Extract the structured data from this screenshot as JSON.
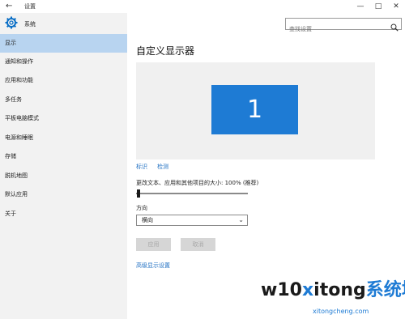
{
  "window": {
    "title": "设置",
    "back_glyph": "←",
    "minimize_glyph": "—",
    "maximize_glyph": "□",
    "close_glyph": "✕"
  },
  "sidebar": {
    "header": "系统",
    "items": [
      {
        "label": "显示",
        "active": true
      },
      {
        "label": "通知和操作"
      },
      {
        "label": "应用和功能"
      },
      {
        "label": "多任务"
      },
      {
        "label": "平板电脑模式"
      },
      {
        "label": "电源和睡眠"
      },
      {
        "label": "存储"
      },
      {
        "label": "脱机地图"
      },
      {
        "label": "默认应用"
      },
      {
        "label": "关于"
      }
    ]
  },
  "search": {
    "placeholder": "查找设置"
  },
  "main": {
    "title": "自定义显示器",
    "monitor_number": "1",
    "identify_link": "标识",
    "detect_link": "检测",
    "scale_label": "更改文本、应用和其他项目的大小: 100% (推荐)",
    "scale_value_percent": 100,
    "orientation_label": "方向",
    "orientation_value": "横向",
    "apply_label": "应用",
    "cancel_label": "取消",
    "advanced_link": "高级显示设置"
  },
  "watermark": {
    "main_prefix": "w10",
    "main_x": "x",
    "main_suffix": "itong",
    "main_cn": "系统城",
    "sub": "xitongcheng.com"
  },
  "colors": {
    "accent": "#1e7bd4",
    "sidebar_bg": "#f2f2f2",
    "active_item_bg": "#b8d4f0",
    "link": "#1f6fc2"
  }
}
